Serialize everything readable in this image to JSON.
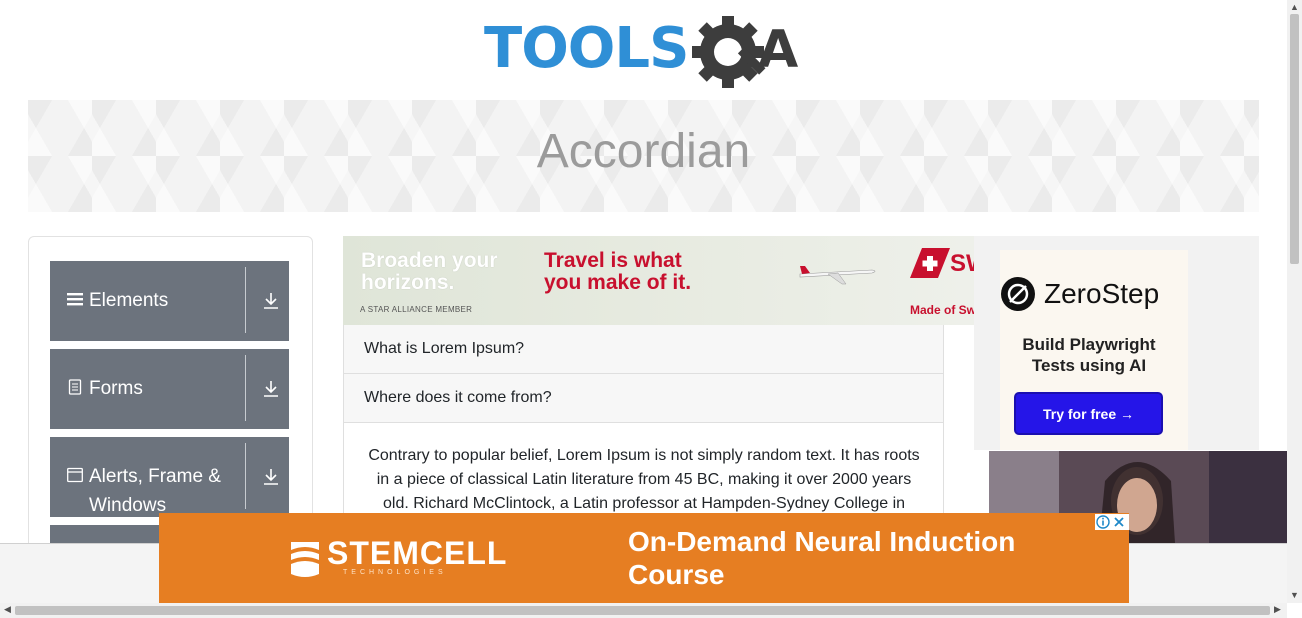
{
  "header": {
    "logo_text": "TOOLSQA"
  },
  "banner": {
    "title": "Accordian"
  },
  "sidebar": {
    "groups": [
      {
        "label": "Elements",
        "icon": "hamburger-icon"
      },
      {
        "label": "Forms",
        "icon": "document-icon"
      },
      {
        "label": "Alerts, Frame & Windows",
        "icon": "window-icon"
      }
    ]
  },
  "ad_top": {
    "left_text": "Broaden your horizons.",
    "headline": "Travel is what you make of it.",
    "member_text": "A STAR ALLIANCE MEMBER",
    "made_text": "Made of Sw",
    "brand_fragment": "SW"
  },
  "accordion": {
    "sections": [
      {
        "heading": "What is Lorem Ipsum?"
      },
      {
        "heading": "Where does it come from?"
      }
    ],
    "body_text": "Contrary to popular belief, Lorem Ipsum is not simply random text. It has roots in a piece of classical Latin literature from 45 BC, making it over 2000 years old. Richard McClintock, a Latin professor at Hampden-Sydney College in"
  },
  "right_ad": {
    "brand": "ZeroStep",
    "tagline": "Build Playwright Tests using AI",
    "cta": "Try for free →"
  },
  "bottom_ad": {
    "brand": "STEMCELL",
    "brand_sub": "TECHNOLOGIES",
    "headline": "On-Demand Neural Induction Course"
  },
  "colors": {
    "sidebar_group_bg": "#6c737d",
    "banner_title": "#9b9b9b",
    "logo_blue": "#2f8fd6",
    "logo_dark": "#3d3d3d",
    "cta_bg": "#2515e8",
    "bottom_ad_bg": "#e67e22"
  }
}
